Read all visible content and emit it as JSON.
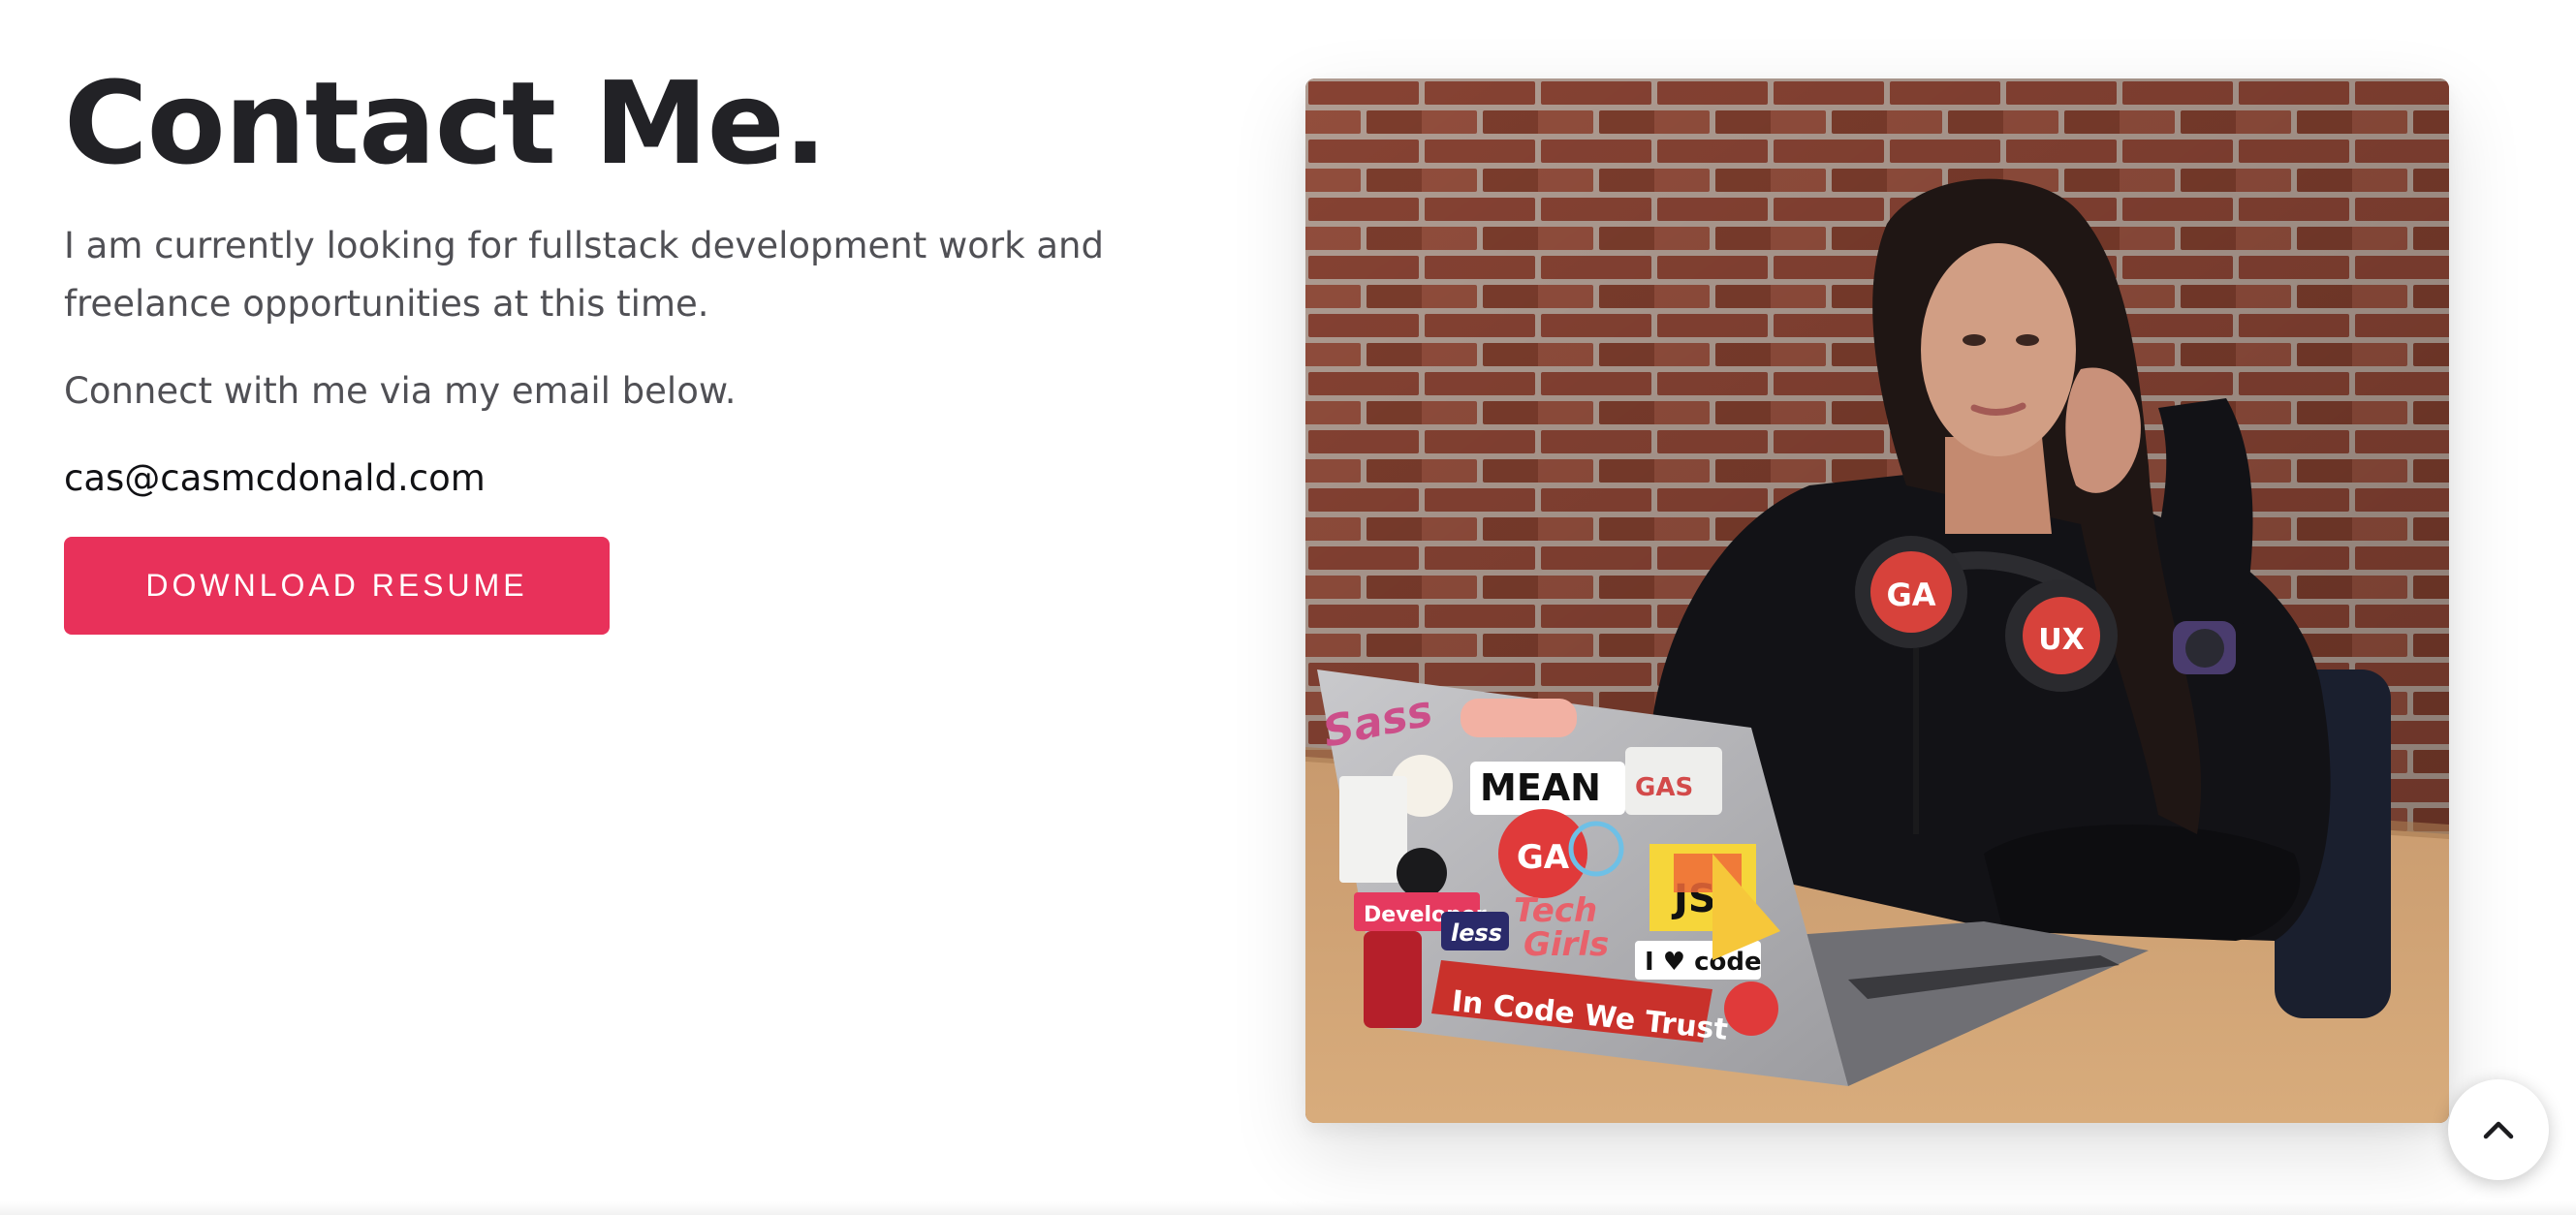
{
  "contact": {
    "title": "Contact Me.",
    "paragraph_1": "I am currently looking for fullstack development work and freelance opportunities at this time.",
    "paragraph_2": "Connect with me via my email below.",
    "email": "cas@casmcdonald.com",
    "resume_button_label": "DOWNLOAD RESUME"
  },
  "photo": {
    "laptop_stickers": [
      "Sass",
      "MEAN",
      "GA",
      "Tech Girls",
      "JS",
      "I ♥ code",
      "In Code We Trust",
      "Developer",
      "less"
    ],
    "headphone_labels": [
      "GA",
      "UX"
    ]
  },
  "icons": {
    "scroll_top": "chevron-up-icon"
  },
  "colors": {
    "accent": "#e8315a",
    "title": "#222226",
    "body_text": "#505055"
  }
}
